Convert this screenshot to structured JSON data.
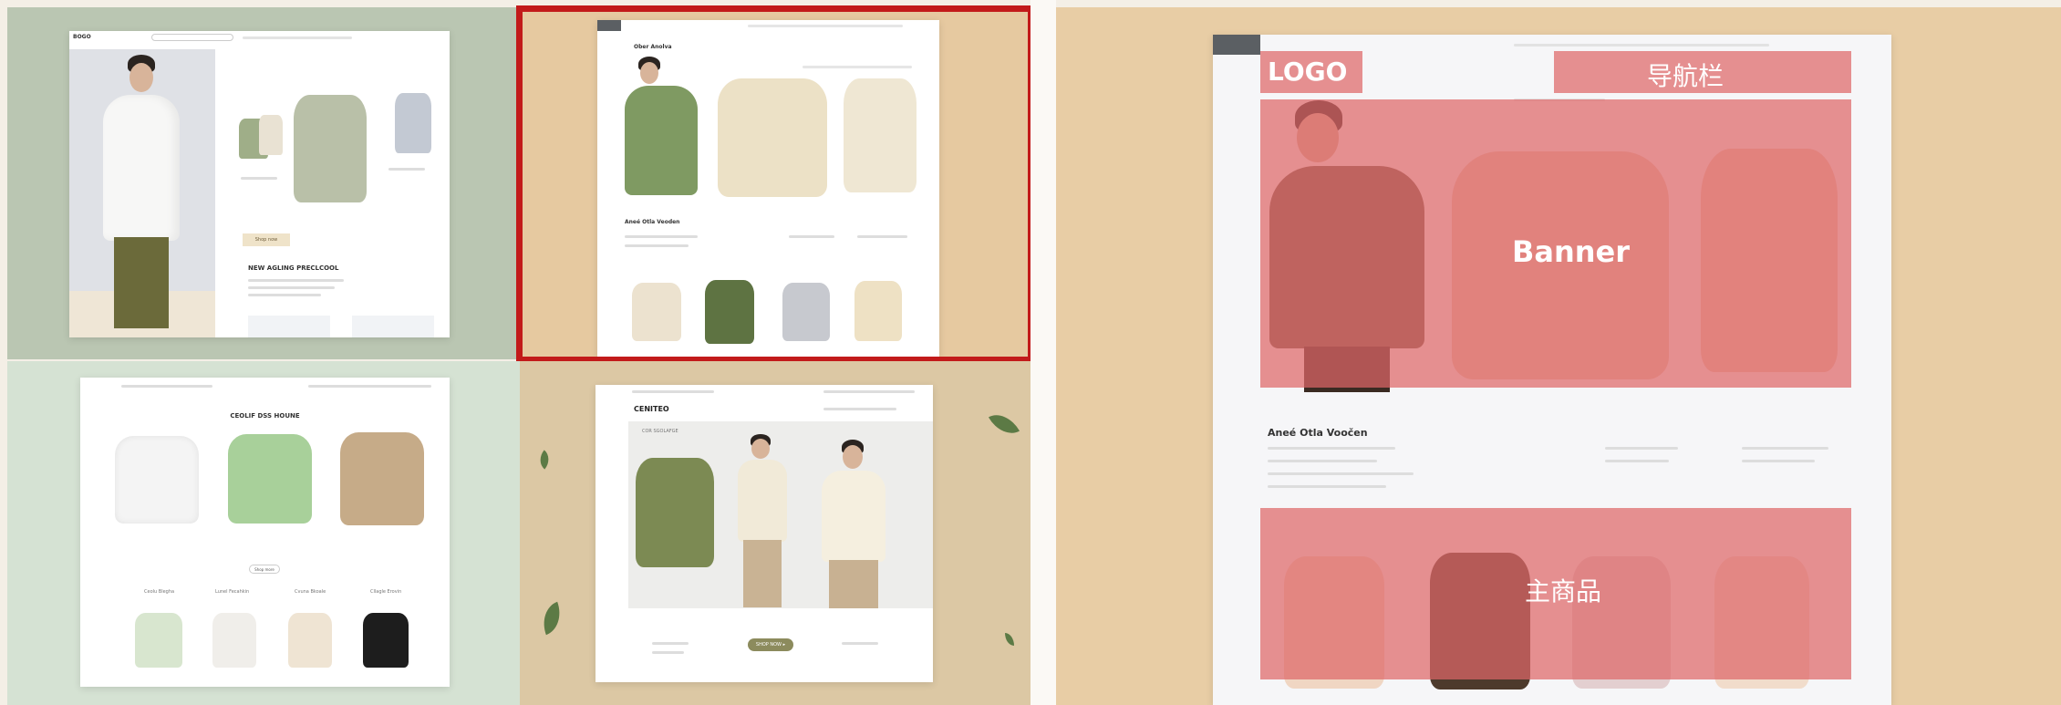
{
  "colors": {
    "highlight_red": "#c21a1a",
    "overlay_pink": "#de6668",
    "sage_bg": "#bac6b2",
    "tan_bg": "#e6c9a0",
    "mint_bg": "#d5e2d3",
    "beige_bg": "#dcc8a4"
  },
  "panel_a": {
    "logo": "BOGO",
    "heading": "NEW AGLING PRECLCOOL",
    "button": "Shop now"
  },
  "panel_b": {
    "brand": "Ober Anolva",
    "section": "Aneé Otla Veoden"
  },
  "panel_c": {
    "heading": "CEOLIF DSS HOUNE",
    "button": "Shop more",
    "captions": [
      "Ceolu Blegha",
      "Lunel Fecahkin",
      "Cvuna Bkoale",
      "Cllagle Erovin"
    ]
  },
  "panel_d": {
    "brand": "CENITEO",
    "sub": "COR SGOLAFGE",
    "button": "SHOP NOW ▸"
  },
  "annotated": {
    "section": "Aneé Otla Voočen",
    "labels": {
      "logo": "LOGO",
      "nav": "导航栏",
      "banner": "Banner",
      "main": "主商品"
    }
  }
}
